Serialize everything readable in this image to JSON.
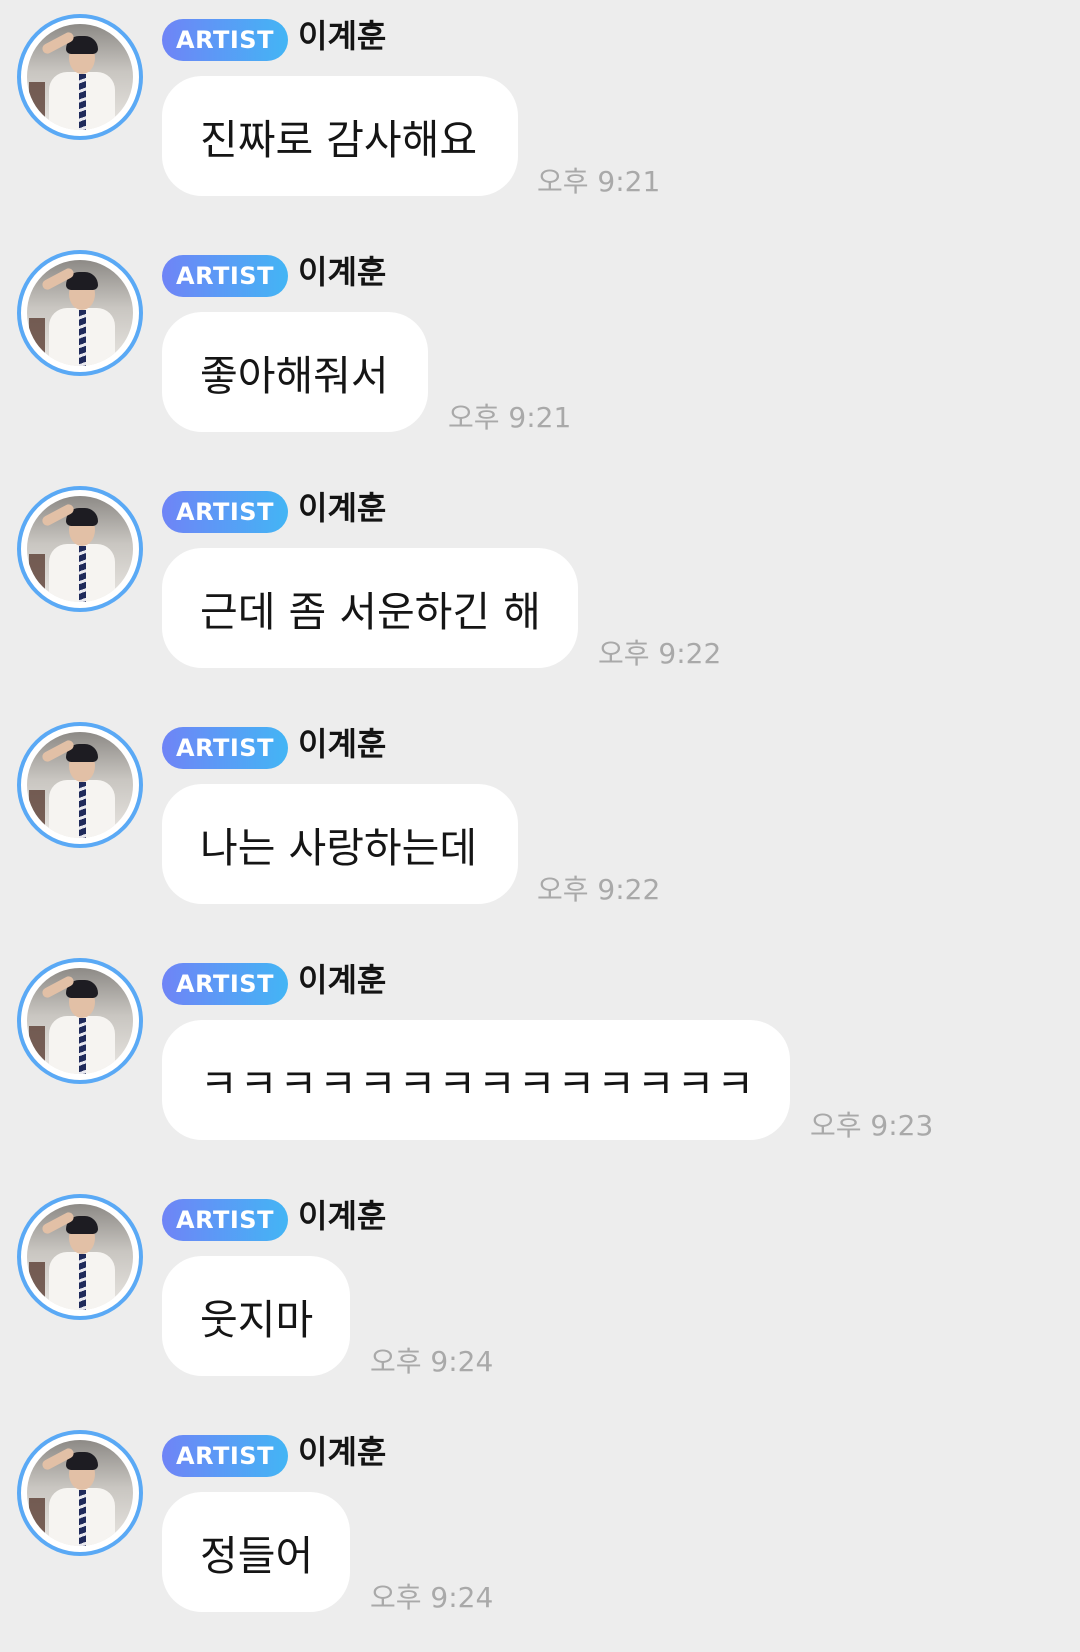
{
  "messages": [
    {
      "badge": "ARTIST",
      "sender": "이계훈",
      "text": "진짜로 감사해요",
      "time": "오후 9:21"
    },
    {
      "badge": "ARTIST",
      "sender": "이계훈",
      "text": "좋아해줘서",
      "time": "오후 9:21"
    },
    {
      "badge": "ARTIST",
      "sender": "이계훈",
      "text": "근데 좀 서운하긴 해",
      "time": "오후 9:22"
    },
    {
      "badge": "ARTIST",
      "sender": "이계훈",
      "text": "나는 사랑하는데",
      "time": "오후 9:22"
    },
    {
      "badge": "ARTIST",
      "sender": "이계훈",
      "text": "ㅋㅋㅋㅋㅋㅋㅋㅋㅋㅋㅋㅋㅋㅋ",
      "time": "오후 9:23"
    },
    {
      "badge": "ARTIST",
      "sender": "이계훈",
      "text": "웃지마",
      "time": "오후 9:24"
    },
    {
      "badge": "ARTIST",
      "sender": "이계훈",
      "text": "정들어",
      "time": "오후 9:24"
    }
  ]
}
